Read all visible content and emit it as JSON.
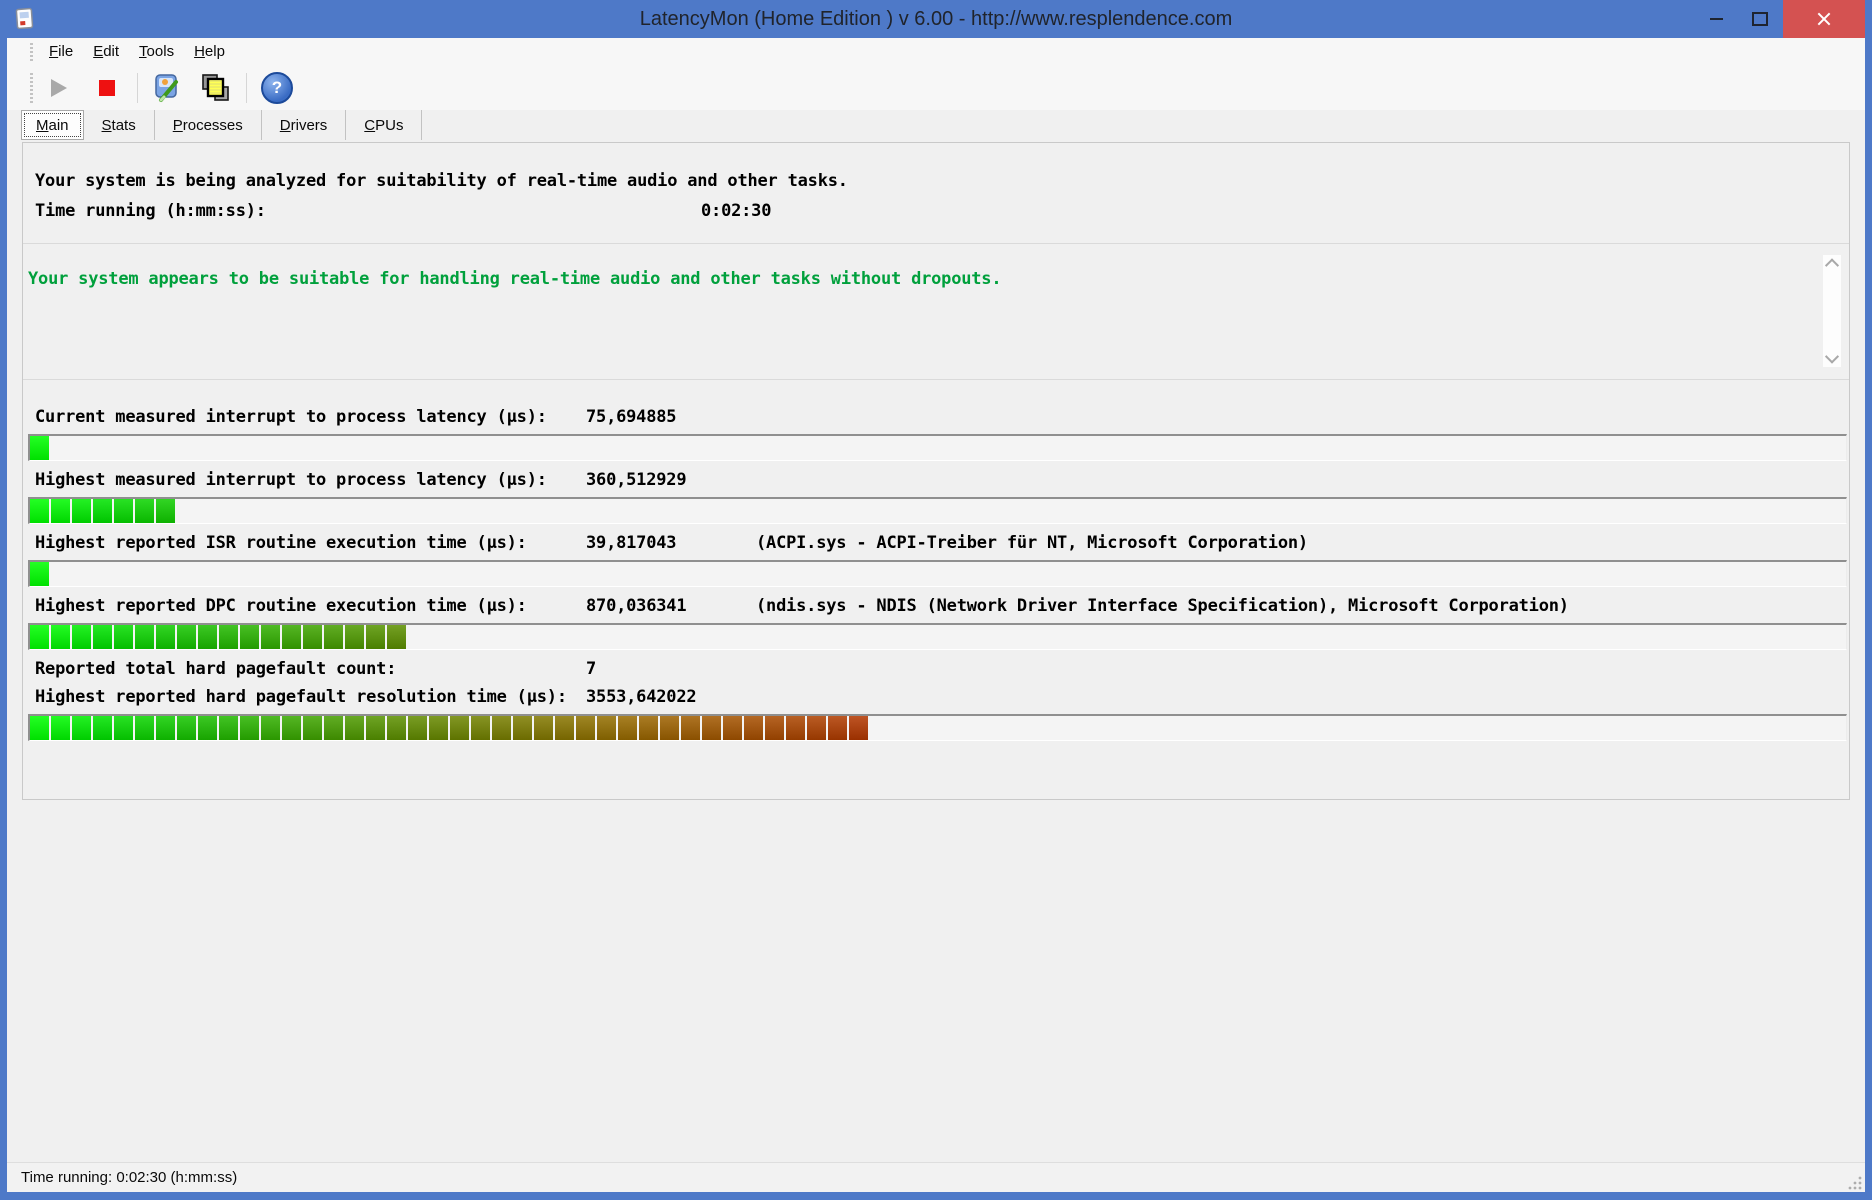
{
  "window": {
    "title": "LatencyMon  (Home Edition )  v 6.00 - http://www.resplendence.com"
  },
  "menu": {
    "items": [
      "File",
      "Edit",
      "Tools",
      "Help"
    ]
  },
  "toolbar": {
    "icons": [
      "play-icon",
      "stop-icon",
      "monitor-pen-icon",
      "stacked-windows-icon",
      "question-icon"
    ]
  },
  "tabs": [
    {
      "label": "Main",
      "active": true
    },
    {
      "label": "Stats",
      "active": false
    },
    {
      "label": "Processes",
      "active": false
    },
    {
      "label": "Drivers",
      "active": false
    },
    {
      "label": "CPUs",
      "active": false
    }
  ],
  "main": {
    "analysis_line": "Your system is being analyzed for suitability of real-time audio and other tasks.",
    "time_label": "Time running (h:mm:ss):",
    "time_value": "0:02:30",
    "verdict": "Your system appears to be suitable for handling real-time audio and other tasks without dropouts.",
    "measurements": [
      {
        "label": "Current measured interrupt to process latency (µs):",
        "value": "75,694885",
        "extra": "",
        "segments": 1
      },
      {
        "label": "Highest measured interrupt to process latency (µs):",
        "value": "360,512929",
        "extra": "",
        "segments": 7
      },
      {
        "label": "Highest reported ISR routine execution time (µs):",
        "value": "39,817043",
        "extra": "(ACPI.sys - ACPI-Treiber für NT, Microsoft Corporation)",
        "segments": 1
      },
      {
        "label": "Highest reported DPC routine execution time (µs):",
        "value": "870,036341",
        "extra": "(ndis.sys - NDIS (Network Driver Interface Specification), Microsoft Corporation)",
        "segments": 18
      },
      {
        "label": "Reported total hard pagefault count:",
        "value": "7",
        "extra": "",
        "segments": null
      },
      {
        "label": "Highest reported hard pagefault resolution time (µs):",
        "value": "3553,642022",
        "extra": "",
        "segments": 40
      }
    ]
  },
  "statusbar": {
    "text": "Time running: 0:02:30  (h:mm:ss)"
  },
  "colors": {
    "titlebar": "#4e79c8",
    "close_button": "#d45251",
    "verdict_text": "#00a03c",
    "stop_icon": "#ee1111",
    "bar_anchors": [
      [
        0,
        [
          0,
          224,
          0
        ]
      ],
      [
        3,
        [
          0,
          196,
          0
        ]
      ],
      [
        8,
        [
          24,
          164,
          0
        ]
      ],
      [
        17,
        [
          80,
          124,
          0
        ]
      ],
      [
        28,
        [
          132,
          92,
          0
        ]
      ],
      [
        39,
        [
          154,
          48,
          0
        ]
      ]
    ]
  }
}
